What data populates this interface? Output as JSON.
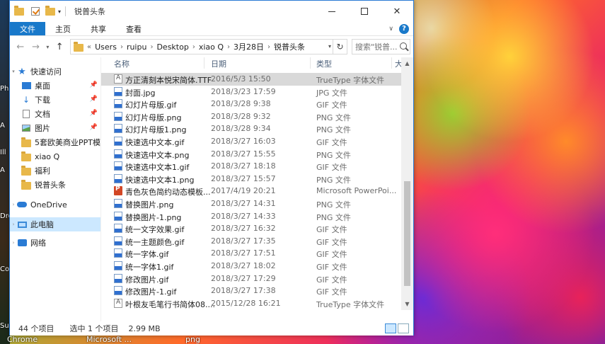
{
  "window": {
    "title": "锐普头条",
    "ribbon_tabs": [
      "文件",
      "主页",
      "共享",
      "查看"
    ]
  },
  "address": {
    "crumbs": [
      "Users",
      "ruipu",
      "Desktop",
      "xiao Q",
      "3月28日",
      "锐普头条"
    ],
    "search_placeholder": "搜索\"锐普..."
  },
  "nav": {
    "quick_access": "快速访问",
    "pinned": [
      "桌面",
      "下载",
      "文档",
      "图片"
    ],
    "folders": [
      "5套欧美商业PPT模板",
      "xiao Q",
      "福利",
      "锐普头条"
    ],
    "onedrive": "OneDrive",
    "this_pc": "此电脑",
    "network": "网络"
  },
  "columns": {
    "name": "名称",
    "date": "日期",
    "type": "类型",
    "size": "大小"
  },
  "files": [
    {
      "name": "方正清刻本悦宋简体.TTF",
      "date": "2016/5/3 15:50",
      "type": "TrueType 字体文件",
      "icon": "font-file-icon",
      "selected": true
    },
    {
      "name": "封面.jpg",
      "date": "2018/3/23 17:59",
      "type": "JPG 文件",
      "icon": "jpg-file-icon"
    },
    {
      "name": "幻灯片母版.gif",
      "date": "2018/3/28 9:38",
      "type": "GIF 文件",
      "icon": "gif-file-icon"
    },
    {
      "name": "幻灯片母版.png",
      "date": "2018/3/28 9:32",
      "type": "PNG 文件",
      "icon": "png-file-icon"
    },
    {
      "name": "幻灯片母版1.png",
      "date": "2018/3/28 9:34",
      "type": "PNG 文件",
      "icon": "png-file-icon"
    },
    {
      "name": "快速选中文本.gif",
      "date": "2018/3/27 16:03",
      "type": "GIF 文件",
      "icon": "gif-file-icon"
    },
    {
      "name": "快速选中文本.png",
      "date": "2018/3/27 15:55",
      "type": "PNG 文件",
      "icon": "png-file-icon"
    },
    {
      "name": "快速选中文本1.gif",
      "date": "2018/3/27 18:18",
      "type": "GIF 文件",
      "icon": "gif-file-icon"
    },
    {
      "name": "快速选中文本1.png",
      "date": "2018/3/27 15:57",
      "type": "PNG 文件",
      "icon": "png-file-icon"
    },
    {
      "name": "青色灰色简约动态模板...",
      "date": "2017/4/19 20:21",
      "type": "Microsoft PowerPoi...",
      "icon": "ppt-file-icon"
    },
    {
      "name": "替换图片.png",
      "date": "2018/3/27 14:31",
      "type": "PNG 文件",
      "icon": "png-file-icon"
    },
    {
      "name": "替换图片-1.png",
      "date": "2018/3/27 14:33",
      "type": "PNG 文件",
      "icon": "png-file-icon"
    },
    {
      "name": "统一文字效果.gif",
      "date": "2018/3/27 16:32",
      "type": "GIF 文件",
      "icon": "gif-file-icon"
    },
    {
      "name": "统一主题颜色.gif",
      "date": "2018/3/27 17:35",
      "type": "GIF 文件",
      "icon": "gif-file-icon"
    },
    {
      "name": "统一字体.gif",
      "date": "2018/3/27 17:51",
      "type": "GIF 文件",
      "icon": "gif-file-icon"
    },
    {
      "name": "统一字体1.gif",
      "date": "2018/3/27 18:02",
      "type": "GIF 文件",
      "icon": "gif-file-icon"
    },
    {
      "name": "修改图片.gif",
      "date": "2018/3/27 17:29",
      "type": "GIF 文件",
      "icon": "gif-file-icon"
    },
    {
      "name": "修改图片-1.gif",
      "date": "2018/3/27 17:38",
      "type": "GIF 文件",
      "icon": "gif-file-icon"
    },
    {
      "name": "叶根友毛笔行书简体08....",
      "date": "2015/12/28 16:21",
      "type": "TrueType 字体文件",
      "icon": "font-file-icon"
    }
  ],
  "status": {
    "count": "44 个项目",
    "selected": "选中 1 个项目",
    "size": "2.99 MB"
  },
  "desktop": {
    "left_labels": [
      "Ph",
      "A",
      "Ill",
      "A",
      "Dre",
      "Co",
      "Sui"
    ],
    "taskbar": [
      "Chrome",
      "Microsoft ...",
      "png"
    ]
  }
}
